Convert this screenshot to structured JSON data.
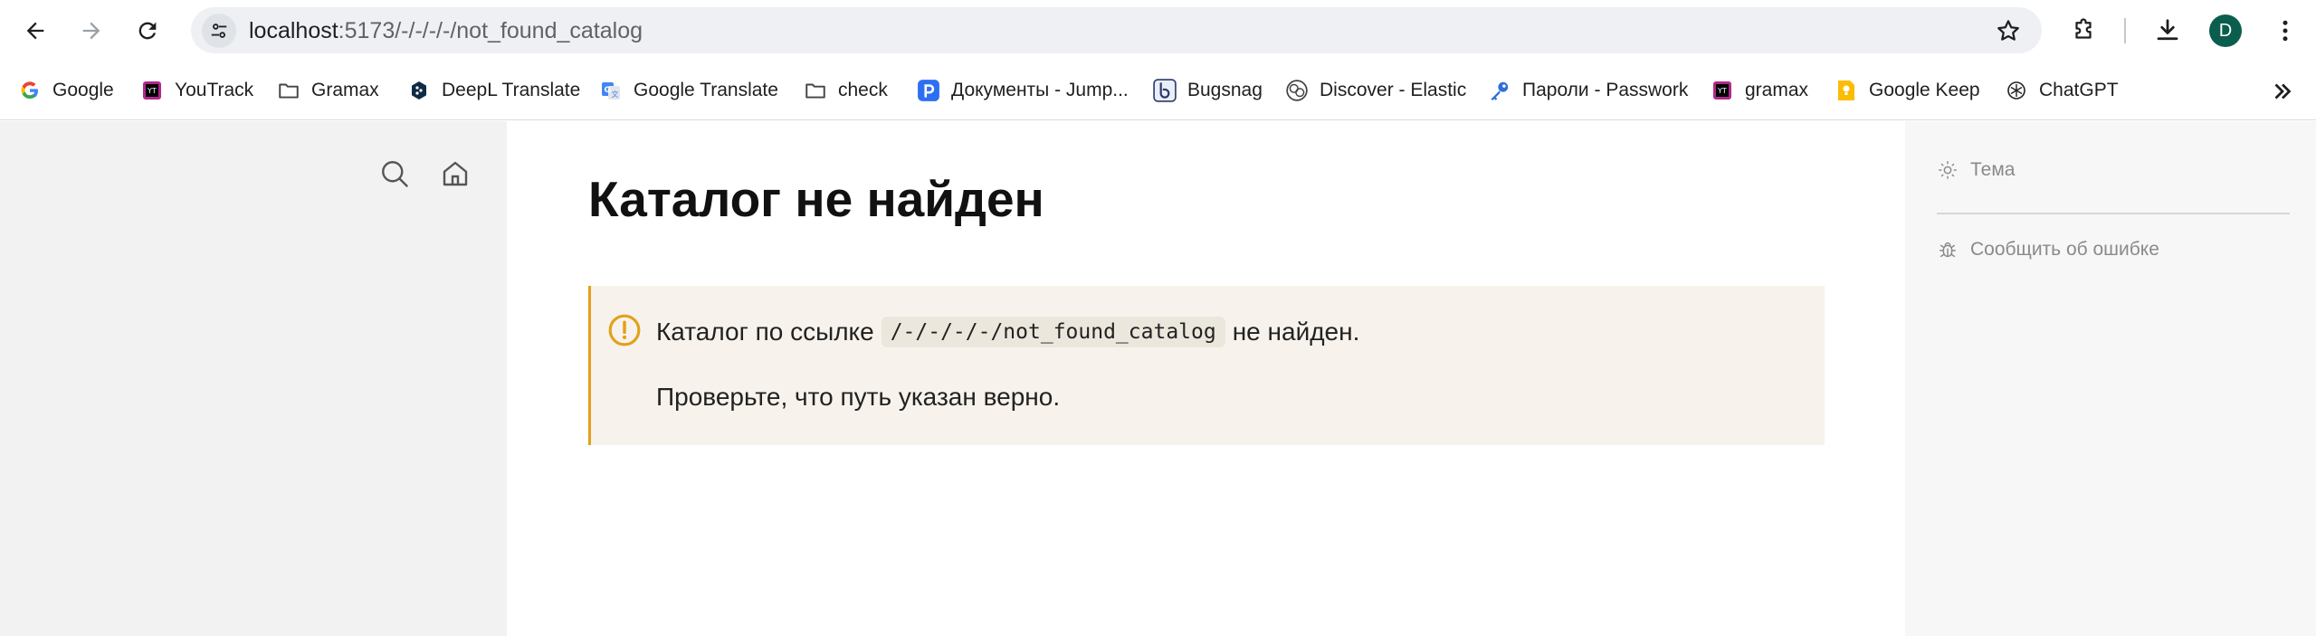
{
  "browser": {
    "url_host": "localhost",
    "url_path": ":5173/-/-/-/-/not_found_catalog",
    "profile_initial": "D",
    "bookmarks": [
      {
        "label": "Google",
        "icon": "google-icon"
      },
      {
        "label": "YouTrack",
        "icon": "youtrack-icon"
      },
      {
        "label": "Gramax",
        "icon": "folder-icon"
      },
      {
        "label": "DeepL Translate",
        "icon": "deepl-icon"
      },
      {
        "label": "Google Translate",
        "icon": "google-translate-icon"
      },
      {
        "label": "check",
        "icon": "folder-icon"
      },
      {
        "label": "Документы - Jump...",
        "icon": "jump-icon"
      },
      {
        "label": "Bugsnag",
        "icon": "bugsnag-icon"
      },
      {
        "label": "Discover - Elastic",
        "icon": "elastic-icon"
      },
      {
        "label": "Пароли - Passwork",
        "icon": "key-icon"
      },
      {
        "label": "gramax",
        "icon": "gramax-icon"
      },
      {
        "label": "Google Keep",
        "icon": "keep-icon"
      },
      {
        "label": "ChatGPT",
        "icon": "chatgpt-icon"
      }
    ]
  },
  "page": {
    "title": "Каталог не найден",
    "callout": {
      "text_before": "Каталог по ссылке",
      "code": "/-/-/-/-/not_found_catalog",
      "text_after": "не найден.",
      "text_line2": "Проверьте, что путь указан верно."
    },
    "right_panel": {
      "theme_label": "Тема",
      "report_label": "Сообщить об ошибке"
    }
  },
  "colors": {
    "callout_accent": "#e2a11a",
    "callout_bg": "#f7f3ec",
    "avatar_bg": "#0b5e4d"
  }
}
